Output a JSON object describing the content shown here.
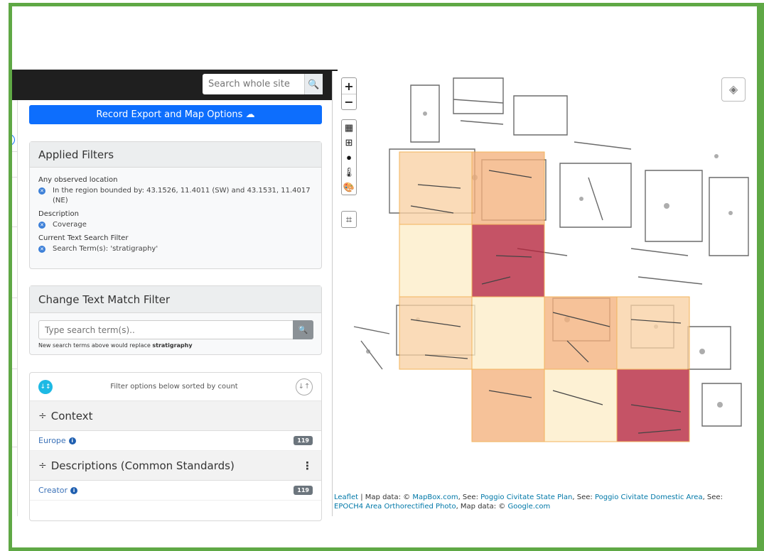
{
  "header": {
    "search_placeholder": "Search whole site",
    "search_icon": "search-icon"
  },
  "export_button": {
    "label": "Record Export and Map Options",
    "icon": "cloud-download-icon",
    "color": "#0d6efd"
  },
  "applied_filters": {
    "title": "Applied Filters",
    "groups": [
      {
        "title": "Any observed location",
        "value": "In the region bounded by: 43.1526, 11.4011 (SW) and 43.1531, 11.4017 (NE)"
      },
      {
        "title": "Description",
        "value": "Coverage"
      },
      {
        "title": "Current Text Search Filter",
        "value": "Search Term(s): 'stratigraphy'"
      }
    ]
  },
  "text_filter": {
    "title": "Change Text Match Filter",
    "placeholder": "Type search term(s)..",
    "note_prefix": "New search terms above would replace ",
    "note_term": "stratigraphy"
  },
  "facets": {
    "sort_label": "Filter options below sorted by count",
    "sections": [
      {
        "title": "Context",
        "items": [
          {
            "label": "Europe",
            "count": "119"
          }
        ]
      },
      {
        "title": "Descriptions (Common Standards)",
        "items": [
          {
            "label": "Creator",
            "count": "119"
          }
        ]
      }
    ]
  },
  "map": {
    "zoom_in": "+",
    "zoom_out": "−",
    "tool_icons": [
      "grid-fine-icon",
      "grid-coarse-icon",
      "circle-icon",
      "thermometer-icon",
      "palette-icon"
    ],
    "crop_icon": "crop-icon",
    "layers_icon": "layers-icon",
    "heat_colors": {
      "low": "#fdeec8",
      "mid": "#f9d2a5",
      "high": "#f4b17d",
      "max": "#b5243c"
    },
    "attribution": {
      "leaflet": "Leaflet",
      "map_data_1": " | Map data: © ",
      "mapbox": "MapBox.com",
      "see1": ", See: ",
      "plan": "Poggio Civitate State Plan",
      "see2": ", See: ",
      "domestic": "Poggio Civitate Domestic Area",
      "see3": ", See: ",
      "epoch": "EPOCH4 Area Orthorectified Photo",
      "map_data_2": ", Map data: © ",
      "google": "Google.com"
    }
  }
}
